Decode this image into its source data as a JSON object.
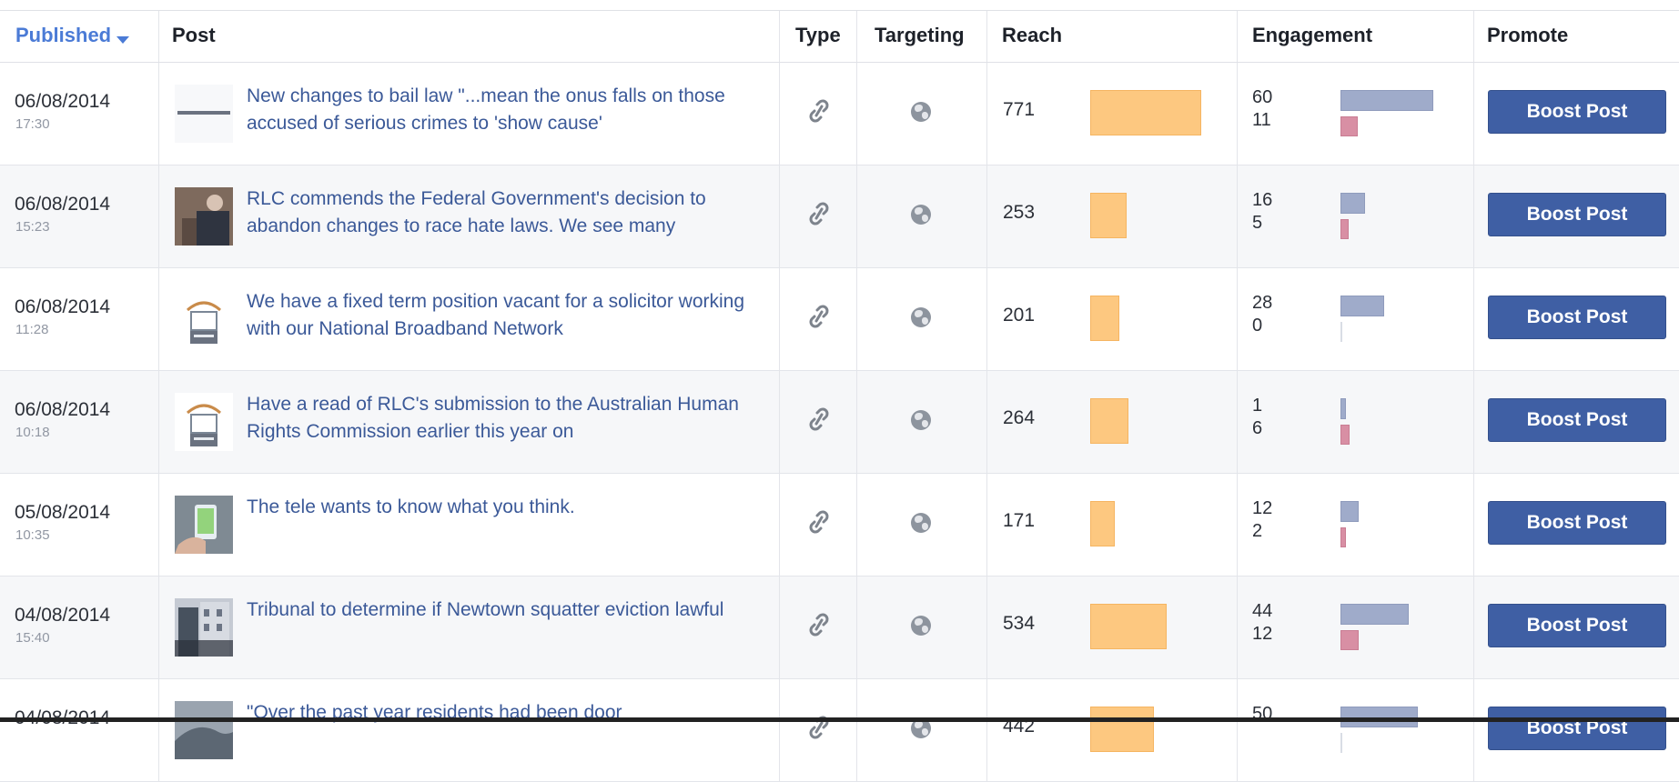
{
  "header": {
    "published": "Published",
    "post": "Post",
    "type": "Type",
    "targeting": "Targeting",
    "reach": "Reach",
    "engagement": "Engagement",
    "promote": "Promote"
  },
  "rows": [
    {
      "date": "06/08/2014",
      "time": "17:30",
      "text": "New changes to bail law \"...mean the onus falls on those accused of serious crimes to 'show cause'",
      "reach": "771",
      "reach_value": 771,
      "eng1": "60",
      "eng2": "11",
      "eng1_value": 60,
      "eng2_value": 11,
      "boost": "Boost Post",
      "thumb": "newspaper-thumbnail",
      "type_icon": "link-icon",
      "targeting_icon": "globe-icon"
    },
    {
      "date": "06/08/2014",
      "time": "15:23",
      "text": "RLC commends the Federal Government's decision to abandon changes to race hate laws. We see many",
      "reach": "253",
      "reach_value": 253,
      "eng1": "16",
      "eng2": "5",
      "eng1_value": 16,
      "eng2_value": 5,
      "boost": "Boost Post",
      "thumb": "person-thumbnail",
      "type_icon": "link-icon",
      "targeting_icon": "globe-icon"
    },
    {
      "date": "06/08/2014",
      "time": "11:28",
      "text": "We have a fixed term position vacant for a solicitor working with our National Broadband Network",
      "reach": "201",
      "reach_value": 201,
      "eng1": "28",
      "eng2": "0",
      "eng1_value": 28,
      "eng2_value": 0,
      "boost": "Boost Post",
      "thumb": "logo-thumbnail",
      "type_icon": "link-icon",
      "targeting_icon": "globe-icon"
    },
    {
      "date": "06/08/2014",
      "time": "10:18",
      "text": "Have a read of RLC's submission to the Australian Human Rights Commission earlier this year on",
      "reach": "264",
      "reach_value": 264,
      "eng1": "1",
      "eng2": "6",
      "eng1_value": 1,
      "eng2_value": 6,
      "boost": "Boost Post",
      "thumb": "logo-thumbnail",
      "type_icon": "link-icon",
      "targeting_icon": "globe-icon"
    },
    {
      "date": "05/08/2014",
      "time": "10:35",
      "text": "The tele wants to know what you think.",
      "reach": "171",
      "reach_value": 171,
      "eng1": "12",
      "eng2": "2",
      "eng1_value": 12,
      "eng2_value": 2,
      "boost": "Boost Post",
      "thumb": "phone-thumbnail",
      "type_icon": "link-icon",
      "targeting_icon": "globe-icon"
    },
    {
      "date": "04/08/2014",
      "time": "15:40",
      "text": "Tribunal to determine if Newtown squatter eviction lawful",
      "reach": "534",
      "reach_value": 534,
      "eng1": "44",
      "eng2": "12",
      "eng1_value": 44,
      "eng2_value": 12,
      "boost": "Boost Post",
      "thumb": "building-thumbnail",
      "type_icon": "link-icon",
      "targeting_icon": "globe-icon"
    },
    {
      "date": "04/08/2014",
      "time": "",
      "text": "\"Over the past year residents had been door",
      "reach": "442",
      "reach_value": 442,
      "eng1": "50",
      "eng2": "",
      "eng1_value": 50,
      "eng2_value": 0,
      "boost": "Boost Post",
      "thumb": "street-thumbnail",
      "type_icon": "link-icon",
      "targeting_icon": "globe-icon"
    }
  ],
  "colors": {
    "link": "#3b5998",
    "reach_bar": "#fdc880",
    "eng_bar": "#9fabca",
    "eng_bar2": "#d88fa4",
    "boost": "#3f5fa4"
  }
}
